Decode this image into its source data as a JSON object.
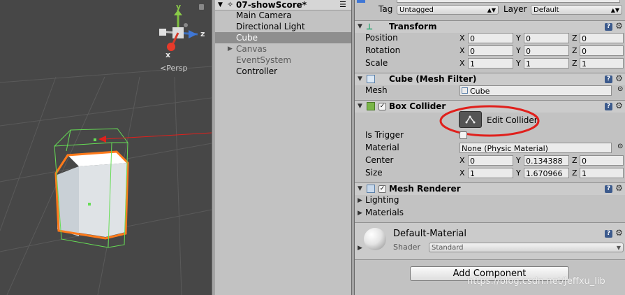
{
  "scene": {
    "persp_label": "<Persp",
    "axis_y": "y",
    "axis_z": "z",
    "axis_x": "x"
  },
  "hierarchy": {
    "scene_name": "07-showScore*",
    "items": [
      {
        "label": "Main Camera"
      },
      {
        "label": "Directional Light"
      },
      {
        "label": "Cube"
      },
      {
        "label": "Canvas"
      },
      {
        "label": "EventSystem"
      },
      {
        "label": "Controller"
      }
    ]
  },
  "inspector": {
    "tag_label": "Tag",
    "tag_value": "Untagged",
    "layer_label": "Layer",
    "layer_value": "Default",
    "transform": {
      "title": "Transform",
      "rows": [
        {
          "label": "Position",
          "x": "0",
          "y": "0",
          "z": "0"
        },
        {
          "label": "Rotation",
          "x": "0",
          "y": "0",
          "z": "0"
        },
        {
          "label": "Scale",
          "x": "1",
          "y": "1",
          "z": "1"
        }
      ]
    },
    "mesh_filter": {
      "title": "Cube (Mesh Filter)",
      "mesh_label": "Mesh",
      "mesh_value": "Cube"
    },
    "box_collider": {
      "title": "Box Collider",
      "edit_label": "Edit Collider",
      "is_trigger_label": "Is Trigger",
      "material_label": "Material",
      "material_value": "None (Physic Material)",
      "center_label": "Center",
      "center": {
        "x": "0",
        "y": "0.134388",
        "z": "0"
      },
      "size_label": "Size",
      "size": {
        "x": "1",
        "y": "1.670966",
        "z": "1"
      }
    },
    "mesh_renderer": {
      "title": "Mesh Renderer",
      "lighting_label": "Lighting",
      "materials_label": "Materials"
    },
    "material": {
      "name": "Default-Material",
      "shader_label": "Shader",
      "shader_value": "Standard"
    },
    "add_component": "Add Component",
    "axis_letters": {
      "x": "X",
      "y": "Y",
      "z": "Z"
    }
  },
  "watermark": "https://blog.csdn.net/Jeffxu_lib",
  "colors": {
    "selection_outline": "#ff7a1a",
    "collider_green": "#66dd55",
    "annotation_red": "#e0201c"
  }
}
